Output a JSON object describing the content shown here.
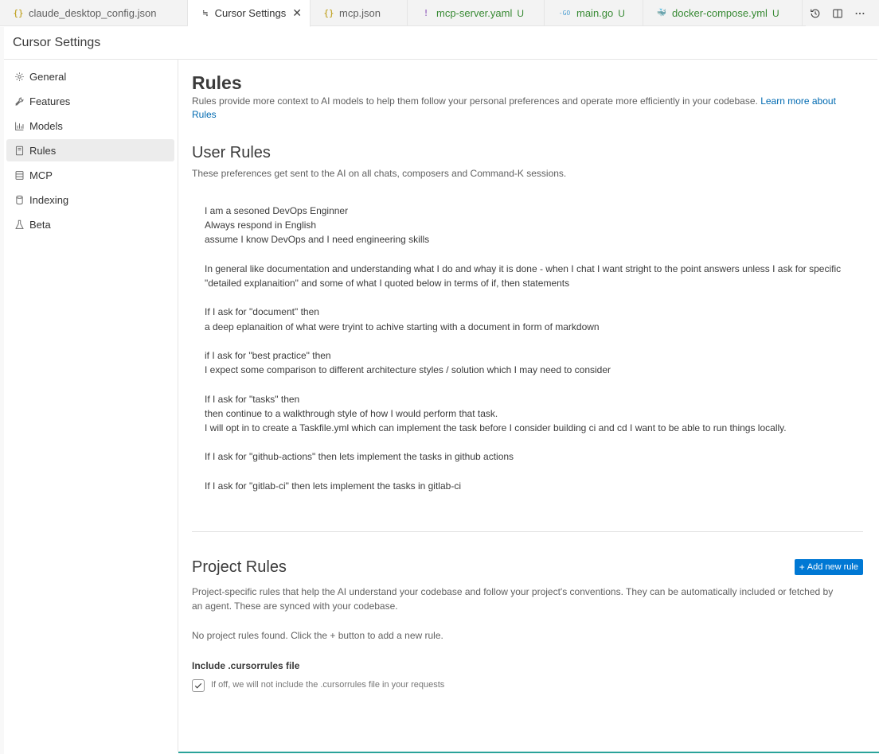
{
  "tabs": [
    {
      "icon": "{}",
      "label": "claude_desktop_config.json",
      "badge": "",
      "color": "#b89500"
    },
    {
      "icon": "≒",
      "label": "Cursor Settings",
      "badge": "",
      "close": "✕"
    },
    {
      "icon": "{}",
      "label": "mcp.json",
      "badge": "",
      "color": "#b89500"
    },
    {
      "icon": "!",
      "label": "mcp-server.yaml",
      "badge": "U",
      "color": "#a074c4"
    },
    {
      "icon": "-GO",
      "label": "main.go",
      "badge": "U",
      "color": "#4e9fd1"
    },
    {
      "icon": "🐳",
      "label": "docker-compose.yml",
      "badge": "U",
      "color": "#e44d7c"
    }
  ],
  "settings_title": "Cursor Settings",
  "sidebar": {
    "items": [
      {
        "label": "General",
        "icon": "gear-icon"
      },
      {
        "label": "Features",
        "icon": "tools-icon"
      },
      {
        "label": "Models",
        "icon": "chart-icon"
      },
      {
        "label": "Rules",
        "icon": "book-icon"
      },
      {
        "label": "MCP",
        "icon": "server-icon"
      },
      {
        "label": "Indexing",
        "icon": "database-icon"
      },
      {
        "label": "Beta",
        "icon": "flask-icon"
      }
    ],
    "active": "Rules"
  },
  "main": {
    "title": "Rules",
    "description": "Rules provide more context to AI models to help them follow your personal preferences and operate more efficiently in your codebase.",
    "learn_more": "Learn more about Rules",
    "user_rules": {
      "title": "User Rules",
      "subtitle": "These preferences get sent to the AI on all chats, composers and Command-K sessions.",
      "content": "I am a sesoned DevOps Enginner\nAlways respond in English\nassume I know DevOps and I need engineering skills\n\nIn general like documentation and understanding what I do and whay it is done - when I chat I want stright to the point answers unless I ask for specific \"detailed explanaition\" and some of what I quoted below in terms of if, then statements\n\nIf I ask for \"document\" then\na deep eplanaition of what were tryint to achive starting with a document in form of markdown\n\nif I ask for \"best practice\" then\nI expect some comparison to different architecture styles / solution which I may need to consider\n\nIf I ask for \"tasks\" then\nthen continue to a walkthrough style of how I would perform that task.\nI will opt in to create a Taskfile.yml which can implement the task before I consider building ci and cd I want to be able to run things locally.\n\nIf I ask for \"github-actions\" then lets implement the tasks in github actions\n\nIf I ask for \"gitlab-ci\" then lets implement the tasks in gitlab-ci"
    },
    "project_rules": {
      "title": "Project Rules",
      "add_button": "Add new rule",
      "description": "Project-specific rules that help the AI understand your codebase and follow your project's conventions. They can be automatically included or fetched by an agent. These are synced with your codebase.",
      "empty_text": "No project rules found. Click the + button to add a new rule.",
      "include_label": "Include .cursorrules file",
      "include_checked": true,
      "include_description": "If off, we will not include the .cursorrules file in your requests"
    }
  },
  "colors": {
    "accent": "#0078d4",
    "link": "#006ab1",
    "untracked": "#388a34"
  }
}
